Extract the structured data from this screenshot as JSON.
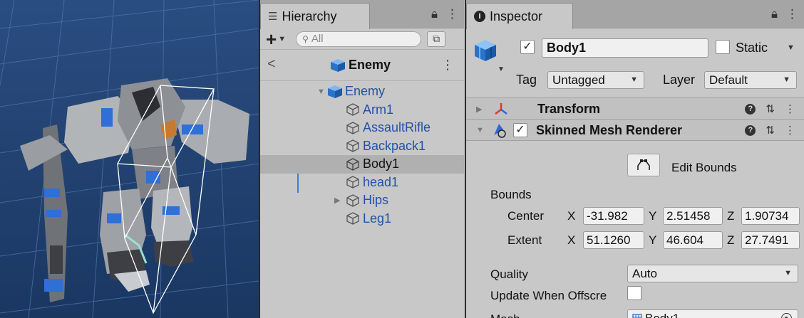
{
  "scene": {
    "label": ""
  },
  "hierarchy": {
    "tab_title": "Hierarchy",
    "search_placeholder": "All",
    "prefab_title": "Enemy",
    "items": [
      {
        "label": "Enemy",
        "root": true
      },
      {
        "label": "Arm1"
      },
      {
        "label": "AssaultRifle"
      },
      {
        "label": "Backpack1"
      },
      {
        "label": "Body1",
        "selected": true
      },
      {
        "label": "head1"
      },
      {
        "label": "Hips",
        "collapsed": true
      },
      {
        "label": "Leg1"
      }
    ]
  },
  "inspector": {
    "tab_title": "Inspector",
    "object_name": "Body1",
    "static_label": "Static",
    "tag_label": "Tag",
    "tag_value": "Untagged",
    "layer_label": "Layer",
    "layer_value": "Default",
    "transform_title": "Transform",
    "smr_title": "Skinned Mesh Renderer",
    "edit_bounds_label": "Edit Bounds",
    "bounds_label": "Bounds",
    "center_label": "Center",
    "extent_label": "Extent",
    "axis_x": "X",
    "axis_y": "Y",
    "axis_z": "Z",
    "center": {
      "x": "-31.982",
      "y": "2.51458",
      "z": "1.90734"
    },
    "extent": {
      "x": "51.1260",
      "y": "46.604",
      "z": "27.7491"
    },
    "quality_label": "Quality",
    "quality_value": "Auto",
    "update_offscreen_label": "Update When Offscre",
    "mesh_label": "Mesh",
    "mesh_value": "Body1"
  },
  "colors": {
    "scene_bg": "#1e3e6a",
    "tree_link": "#2551a8",
    "selection": "#b0b0b0",
    "panel_bg": "#c8c8c8"
  }
}
